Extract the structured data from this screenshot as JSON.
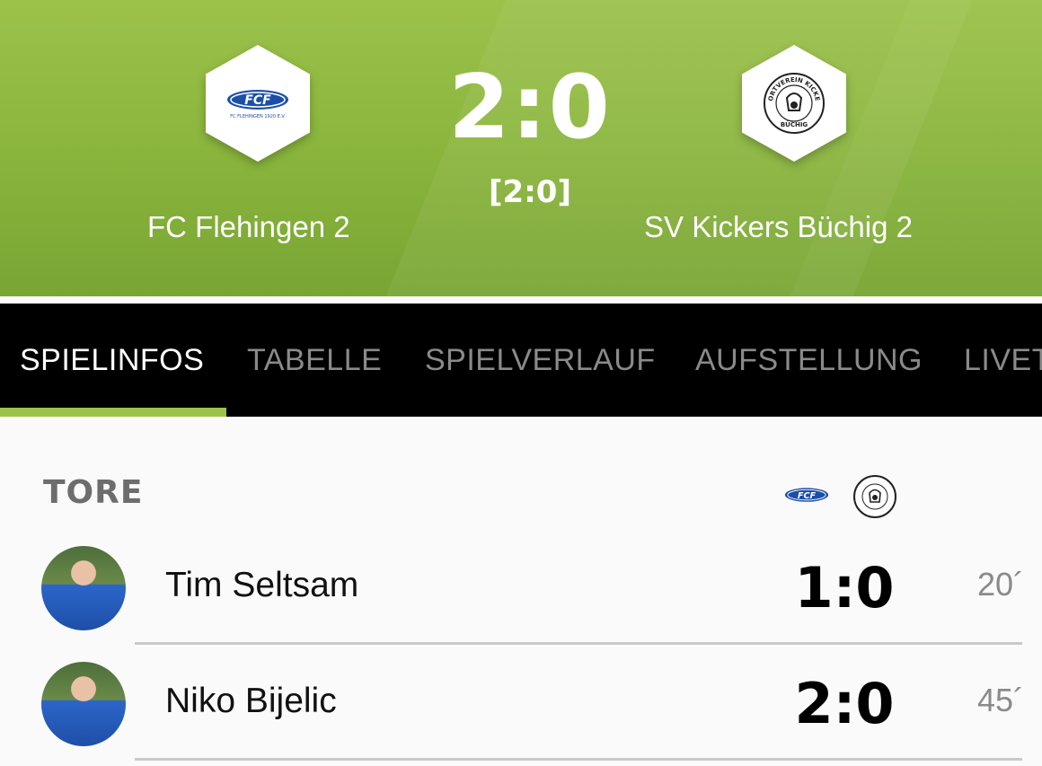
{
  "match": {
    "home_team": "FC Flehingen 2",
    "away_team": "SV Kickers Büchig 2",
    "score": "2:0",
    "halftime_score": "[2:0]",
    "home_logo_text": "FCF",
    "home_logo_subtext": "FC FLEHINGEN 1920 E.V.",
    "away_logo_ring_text": "SPORTVEREIN KICKERS",
    "away_logo_text": "BÜCHIG"
  },
  "tabs": [
    {
      "label": "SPIELINFOS",
      "active": true
    },
    {
      "label": "TABELLE",
      "active": false
    },
    {
      "label": "SPIELVERLAUF",
      "active": false
    },
    {
      "label": "AUFSTELLUNG",
      "active": false
    },
    {
      "label": "LIVET",
      "active": false
    }
  ],
  "goals_section": {
    "title": "TORE",
    "goals": [
      {
        "player": "Tim Seltsam",
        "score": "1:0",
        "minute": "20´"
      },
      {
        "player": "Niko Bijelic",
        "score": "2:0",
        "minute": "45´"
      }
    ]
  },
  "colors": {
    "accent": "#9cc24a",
    "tab_bar": "#000000",
    "home_logo_blue": "#1c4fa8"
  }
}
